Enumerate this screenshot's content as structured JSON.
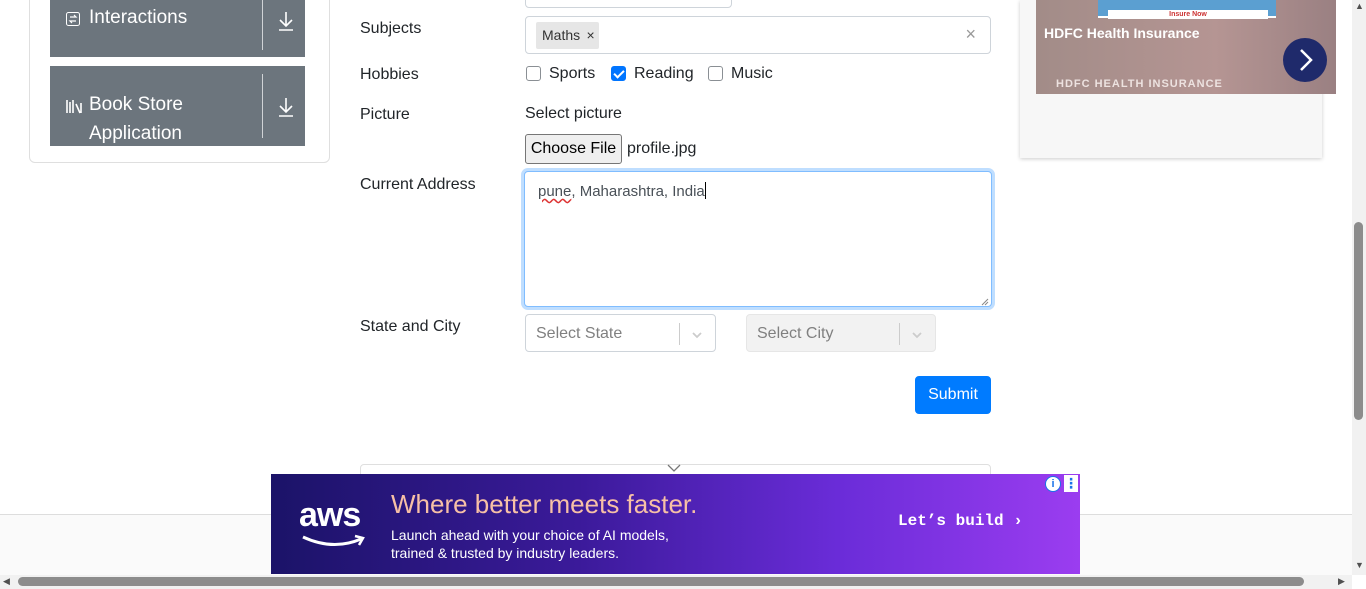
{
  "sidebar": {
    "items": [
      {
        "label": "Interactions",
        "icon": "interactions-icon"
      },
      {
        "label_line1": "Book Store",
        "label_line2": "Application",
        "icon": "book-store-icon"
      }
    ]
  },
  "form": {
    "subjects": {
      "label": "Subjects",
      "chip": "Maths",
      "chip_remove": "×",
      "clear": "×"
    },
    "hobbies": {
      "label": "Hobbies",
      "options": [
        {
          "label": "Sports",
          "checked": false
        },
        {
          "label": "Reading",
          "checked": true
        },
        {
          "label": "Music",
          "checked": false
        }
      ]
    },
    "picture": {
      "label": "Picture",
      "prompt": "Select picture",
      "button": "Choose File",
      "file_name": "profile.jpg"
    },
    "address": {
      "label": "Current Address",
      "misspelled_word": "pune",
      "rest": ", Maharashtra, India"
    },
    "state_city": {
      "label": "State and City",
      "state_placeholder": "Select State",
      "city_placeholder": "Select City"
    },
    "submit": "Submit"
  },
  "ads": {
    "right": {
      "title": "HDFC Health Insurance",
      "subtitle": "HDFC HEALTH INSURANCE",
      "banner_text": "Insure Now",
      "brand_color": "#1f2a6b"
    },
    "bottom": {
      "logo": "aws",
      "headline": "Where better meets faster.",
      "body_line1": "Launch ahead with your choice of AI models,",
      "body_line2": "trained & trusted by industry leaders.",
      "cta": "Let’s build ›",
      "info": "i",
      "more": "⋮"
    }
  },
  "colors": {
    "accent": "#007bff",
    "sidebar": "#6c757d",
    "checkbox": "#0075ff"
  }
}
